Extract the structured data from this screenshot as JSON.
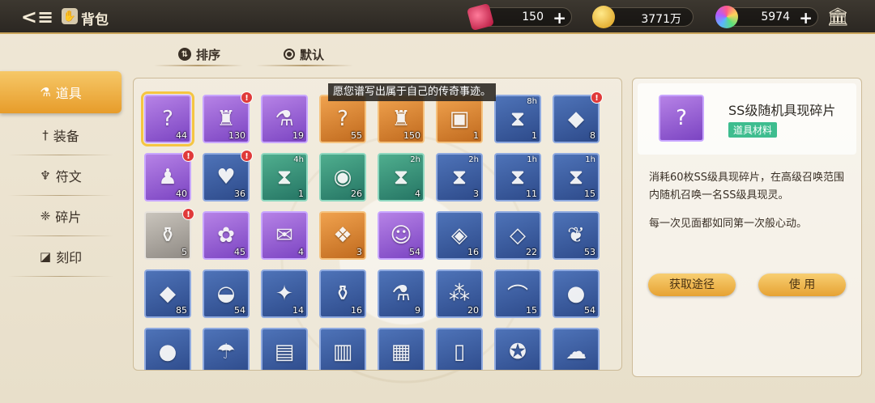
{
  "header": {
    "title": "背包",
    "currencies": [
      {
        "name": "ticket",
        "value": "150"
      },
      {
        "name": "gold",
        "value": "3771万"
      },
      {
        "name": "crystal",
        "value": "5974"
      }
    ]
  },
  "sort": {
    "sort_label": "排序",
    "default_label": "默认"
  },
  "sidebar": {
    "items": [
      {
        "label": "道具",
        "icon": "flask-icon"
      },
      {
        "label": "装备",
        "icon": "sword-icon"
      },
      {
        "label": "符文",
        "icon": "rune-icon"
      },
      {
        "label": "碎片",
        "icon": "shard-icon"
      },
      {
        "label": "刻印",
        "icon": "seal-icon"
      }
    ]
  },
  "tooltip": "愿您谱写出属于自己的传奇事迹。",
  "items": [
    {
      "count": "44",
      "rarity": "purple",
      "icon": "?",
      "selected": true
    },
    {
      "count": "130",
      "rarity": "purple",
      "icon": "♜",
      "badge": true
    },
    {
      "count": "19",
      "rarity": "purple",
      "icon": "⚗"
    },
    {
      "count": "55",
      "rarity": "orange",
      "icon": "?"
    },
    {
      "count": "150",
      "rarity": "orange",
      "icon": "♜"
    },
    {
      "count": "1",
      "rarity": "orange",
      "icon": "▣"
    },
    {
      "count": "1",
      "rarity": "blue",
      "icon": "⧗",
      "timer": "8h"
    },
    {
      "count": "8",
      "rarity": "blue",
      "icon": "◆",
      "badge": true
    },
    {
      "count": "40",
      "rarity": "purple",
      "icon": "♟",
      "badge": true
    },
    {
      "count": "36",
      "rarity": "blue",
      "icon": "♥",
      "badge": true
    },
    {
      "count": "1",
      "rarity": "green",
      "icon": "⧗",
      "timer": "4h"
    },
    {
      "count": "26",
      "rarity": "green",
      "icon": "◉"
    },
    {
      "count": "4",
      "rarity": "green",
      "icon": "⧗",
      "timer": "2h"
    },
    {
      "count": "3",
      "rarity": "blue",
      "icon": "⧗",
      "timer": "2h"
    },
    {
      "count": "11",
      "rarity": "blue",
      "icon": "⧗",
      "timer": "1h"
    },
    {
      "count": "15",
      "rarity": "blue",
      "icon": "⧗",
      "timer": "1h"
    },
    {
      "count": "5",
      "rarity": "gray",
      "icon": "⚱",
      "badge": true
    },
    {
      "count": "45",
      "rarity": "purple",
      "icon": "✿"
    },
    {
      "count": "4",
      "rarity": "purple",
      "icon": "✉"
    },
    {
      "count": "3",
      "rarity": "orange",
      "icon": "❖"
    },
    {
      "count": "54",
      "rarity": "purple",
      "icon": "☺"
    },
    {
      "count": "16",
      "rarity": "blue",
      "icon": "◈"
    },
    {
      "count": "22",
      "rarity": "blue",
      "icon": "◇"
    },
    {
      "count": "53",
      "rarity": "blue",
      "icon": "❦"
    },
    {
      "count": "85",
      "rarity": "blue",
      "icon": "◆"
    },
    {
      "count": "54",
      "rarity": "blue",
      "icon": "◒"
    },
    {
      "count": "14",
      "rarity": "blue",
      "icon": "✦"
    },
    {
      "count": "16",
      "rarity": "blue",
      "icon": "⚱"
    },
    {
      "count": "9",
      "rarity": "blue",
      "icon": "⚗"
    },
    {
      "count": "20",
      "rarity": "blue",
      "icon": "⁂"
    },
    {
      "count": "15",
      "rarity": "blue",
      "icon": "⌒"
    },
    {
      "count": "54",
      "rarity": "blue",
      "icon": "●"
    },
    {
      "count": "",
      "rarity": "blue",
      "icon": "●"
    },
    {
      "count": "",
      "rarity": "blue",
      "icon": "☂"
    },
    {
      "count": "",
      "rarity": "blue",
      "icon": "▤"
    },
    {
      "count": "",
      "rarity": "blue",
      "icon": "▥"
    },
    {
      "count": "",
      "rarity": "blue",
      "icon": "▦"
    },
    {
      "count": "",
      "rarity": "blue",
      "icon": "▯"
    },
    {
      "count": "",
      "rarity": "blue",
      "icon": "✪"
    },
    {
      "count": "",
      "rarity": "blue",
      "icon": "☁"
    }
  ],
  "detail": {
    "name": "SS级随机具现碎片",
    "tag": "道具材料",
    "description": "消耗60枚SS级具现碎片，在高级召唤范围内随机召唤一名SS级具现灵。",
    "flavor": "每一次见面都如同第一次般心动。",
    "source_button": "获取途径",
    "use_button": "使 用"
  },
  "colors": {
    "accent": "#e79c2a",
    "tag_green": "#3ebd8f",
    "badge_red": "#e03a3a",
    "topbar": "#2b2722"
  }
}
